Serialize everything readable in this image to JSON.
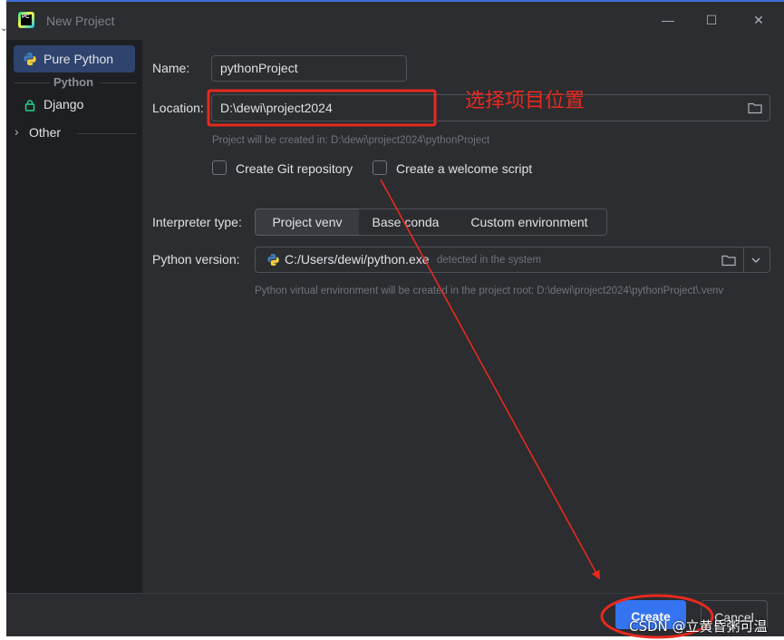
{
  "window": {
    "title": "New Project",
    "controls": [
      "minimize",
      "maximize",
      "close"
    ]
  },
  "sidebar": {
    "selected": "Pure Python",
    "items": [
      {
        "label": "Pure Python",
        "icon": "python-icon"
      },
      {
        "group_header": "Python"
      },
      {
        "label": "Django",
        "icon": "lock-icon"
      },
      {
        "label": "Other",
        "icon": "chevron-right-icon"
      }
    ]
  },
  "form": {
    "name_label": "Name:",
    "name_value": "pythonProject",
    "location_label": "Location:",
    "location_value": "D:\\dewi\\project2024",
    "location_hint": "Project will be created in: D:\\dewi\\project2024\\pythonProject",
    "git_checkbox_label": "Create Git repository",
    "welcome_checkbox_label": "Create a welcome script",
    "interpreter_label": "Interpreter type:",
    "interpreter_options": [
      "Project venv",
      "Base conda",
      "Custom environment"
    ],
    "interpreter_selected": "Project venv",
    "python_version_label": "Python version:",
    "python_version_value": "C:/Users/dewi/python.exe",
    "python_version_detected": "detected in the system",
    "venv_hint": "Python virtual environment will be created in the project root: D:\\dewi\\project2024\\pythonProject\\.venv"
  },
  "footer": {
    "create_label": "Create",
    "cancel_label": "Cancel"
  },
  "annotation": {
    "text": "选择项目位置",
    "color": "#e8291f"
  },
  "watermark": "CSDN @立黄昏粥可温",
  "colors": {
    "accent": "#3574f0",
    "selection": "#2e436e",
    "background": "#2b2d30",
    "sidebar": "#1e1f22"
  }
}
